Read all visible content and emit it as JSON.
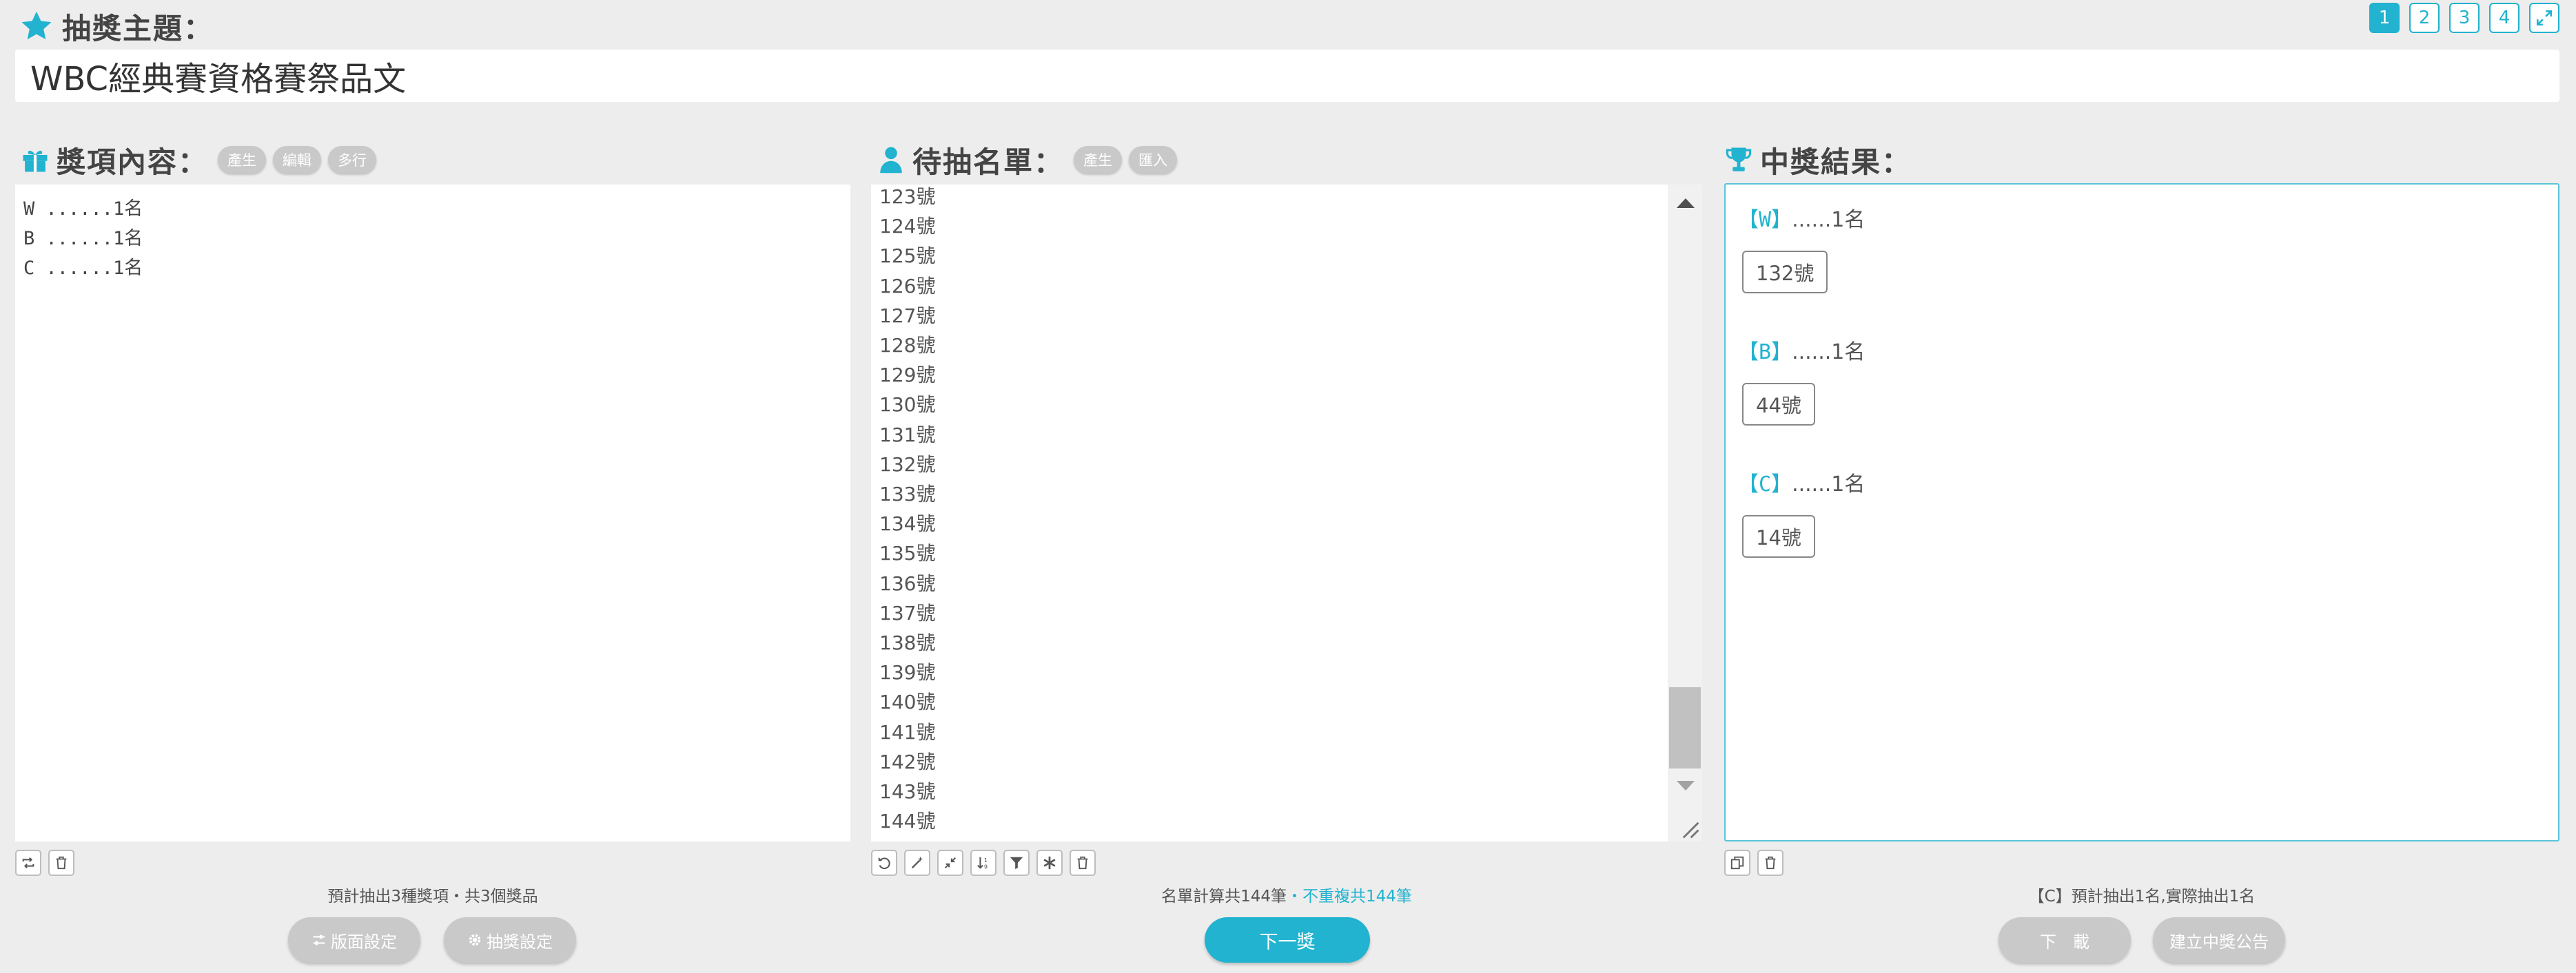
{
  "header": {
    "title_label": "抽獎主題：",
    "topic": "WBC經典賽資格賽祭品文",
    "pages": [
      "1",
      "2",
      "3",
      "4"
    ],
    "active_page": "1"
  },
  "prizes_panel": {
    "label": "獎項內容：",
    "buttons": [
      "產生",
      "編輯",
      "多行"
    ],
    "lines": [
      "W ......1名",
      "B ......1名",
      "C ......1名"
    ],
    "summary": "預計抽出3種獎項・共3個獎品",
    "settings_buttons": [
      "版面設定",
      "抽獎設定"
    ]
  },
  "list_panel": {
    "label": "待抽名單：",
    "buttons": [
      "產生",
      "匯入"
    ],
    "entries": [
      "123號",
      "124號",
      "125號",
      "126號",
      "127號",
      "128號",
      "129號",
      "130號",
      "131號",
      "132號",
      "133號",
      "134號",
      "135號",
      "136號",
      "137號",
      "138號",
      "139號",
      "140號",
      "141號",
      "142號",
      "143號",
      "144號"
    ],
    "summary_main": "名單計算共144筆",
    "summary_unique": "・不重複共144筆",
    "next_button": "下一獎"
  },
  "results_panel": {
    "label": "中獎結果：",
    "results": [
      {
        "bracket": "【W】",
        "count": "......1名",
        "winner": "132號"
      },
      {
        "bracket": "【B】",
        "count": "......1名",
        "winner": "44號"
      },
      {
        "bracket": "【C】",
        "count": "......1名",
        "winner": "14號"
      }
    ],
    "summary": "【C】預計抽出1名,實際抽出1名",
    "download_button": "下　載",
    "announce_button": "建立中獎公告"
  },
  "colors": {
    "accent": "#21b3cf",
    "pill_gray": "#c9c9c9",
    "background": "#ededed"
  }
}
